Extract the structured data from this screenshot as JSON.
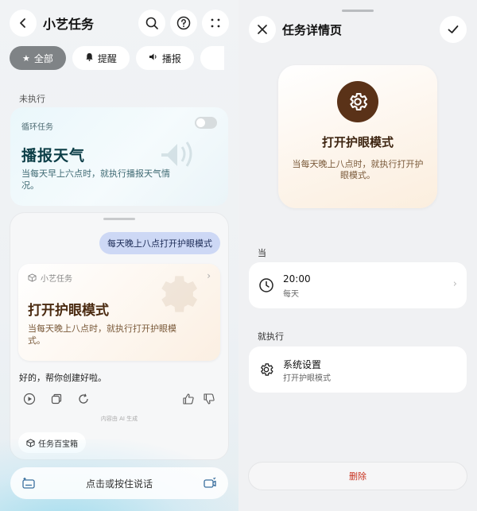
{
  "left": {
    "title": "小艺任务",
    "chips": [
      {
        "label": "全部",
        "icon": "star-icon"
      },
      {
        "label": "提醒",
        "icon": "bell-icon"
      },
      {
        "label": "播报",
        "icon": "speaker-icon"
      }
    ],
    "section_label": "未执行",
    "loop_card": {
      "tag": "循环任务",
      "title": "播报天气",
      "desc": "当每天早上六点时，就执行播报天气情况。"
    },
    "chat": {
      "user_message": "每天晚上八点打开护眼模式",
      "task_card": {
        "tag": "小艺任务",
        "title": "打开护眼模式",
        "desc": "当每天晚上八点时，就执行打开护眼模式。"
      },
      "reply": "好的，帮你创建好啦。",
      "ai_note": "内容由 AI 生成",
      "treasure_label": "任务百宝箱"
    },
    "input_placeholder": "点击或按住说话"
  },
  "right": {
    "title": "任务详情页",
    "hero": {
      "title": "打开护眼模式",
      "desc": "当每天晚上八点时，就执行打开护眼模式。"
    },
    "when_label": "当",
    "when_card": {
      "time": "20:00",
      "repeat": "每天"
    },
    "do_label": "就执行",
    "do_card": {
      "title": "系统设置",
      "sub": "打开护眼模式"
    },
    "delete_label": "删除"
  },
  "colors": {
    "delete": "#c8321f",
    "accent_brown": "#5a3218",
    "bubble": "#cdd8f5"
  }
}
